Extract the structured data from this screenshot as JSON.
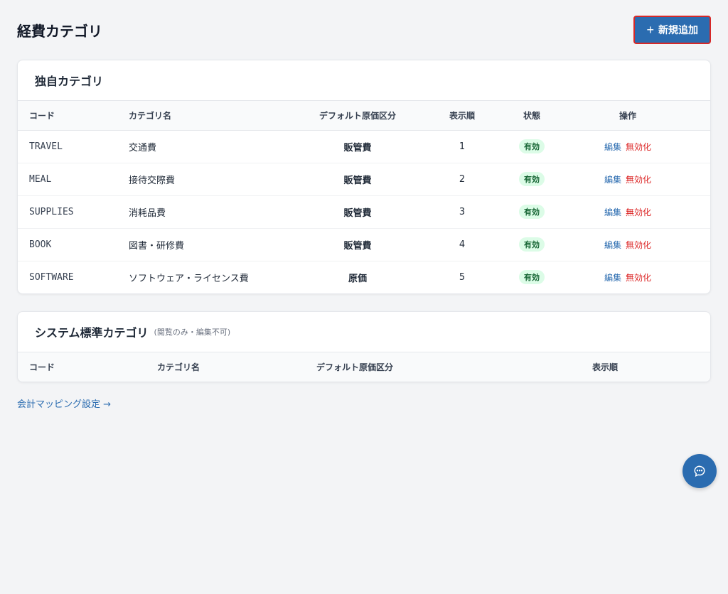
{
  "header": {
    "title": "経費カテゴリ",
    "add_label": "新規追加"
  },
  "custom": {
    "title": "独自カテゴリ",
    "columns": {
      "code": "コード",
      "name": "カテゴリ名",
      "cost": "デフォルト原価区分",
      "order": "表示順",
      "status": "状態",
      "actions": "操作"
    },
    "rows": [
      {
        "code": "TRAVEL",
        "name": "交通費",
        "cost": "販管費",
        "order": "1",
        "status": "有効",
        "edit": "編集",
        "disable": "無効化"
      },
      {
        "code": "MEAL",
        "name": "接待交際費",
        "cost": "販管費",
        "order": "2",
        "status": "有効",
        "edit": "編集",
        "disable": "無効化"
      },
      {
        "code": "SUPPLIES",
        "name": "消耗品費",
        "cost": "販管費",
        "order": "3",
        "status": "有効",
        "edit": "編集",
        "disable": "無効化"
      },
      {
        "code": "BOOK",
        "name": "図書・研修費",
        "cost": "販管費",
        "order": "4",
        "status": "有効",
        "edit": "編集",
        "disable": "無効化"
      },
      {
        "code": "SOFTWARE",
        "name": "ソフトウェア・ライセンス費",
        "cost": "原価",
        "order": "5",
        "status": "有効",
        "edit": "編集",
        "disable": "無効化"
      }
    ]
  },
  "system": {
    "title": "システム標準カテゴリ",
    "note": "(閲覧のみ・編集不可)",
    "columns": {
      "code": "コード",
      "name": "カテゴリ名",
      "cost": "デフォルト原価区分",
      "order": "表示順"
    }
  },
  "mapping_link": "会計マッピング設定 →",
  "icons": {
    "add": "plus-icon",
    "chat": "chat-bubble-icon"
  },
  "colors": {
    "primary": "#2b6cb0",
    "danger": "#dc2626",
    "badge_bg": "#dcfce7",
    "badge_text": "#166534"
  }
}
